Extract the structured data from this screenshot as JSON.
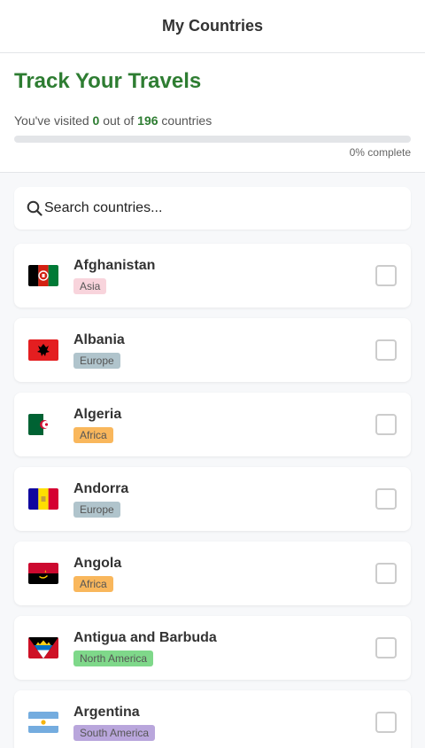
{
  "header": {
    "title": "My Countries"
  },
  "progress": {
    "heading": "Track Your Travels",
    "text_prefix": "You've visited",
    "visited": "0",
    "text_middle": "out of",
    "total": "196",
    "text_suffix": "countries",
    "percent": 0,
    "percent_label": "0% complete"
  },
  "search": {
    "placeholder": "Search countries...",
    "icon": "search-icon"
  },
  "countries": [
    {
      "name": "Afghanistan",
      "continent": "Asia",
      "badge_color": "#f8d4dc",
      "visited": false
    },
    {
      "name": "Albania",
      "continent": "Europe",
      "badge_color": "#b0c4cc",
      "visited": false
    },
    {
      "name": "Algeria",
      "continent": "Africa",
      "badge_color": "#f9b75c",
      "visited": false
    },
    {
      "name": "Andorra",
      "continent": "Europe",
      "badge_color": "#b0c4cc",
      "visited": false
    },
    {
      "name": "Angola",
      "continent": "Africa",
      "badge_color": "#f9b75c",
      "visited": false
    },
    {
      "name": "Antigua and Barbuda",
      "continent": "North America",
      "badge_color": "#7fd88a",
      "visited": false
    },
    {
      "name": "Argentina",
      "continent": "South America",
      "badge_color": "#b9a6dc",
      "visited": false
    }
  ],
  "colors": {
    "accent": "#2e7d32"
  }
}
